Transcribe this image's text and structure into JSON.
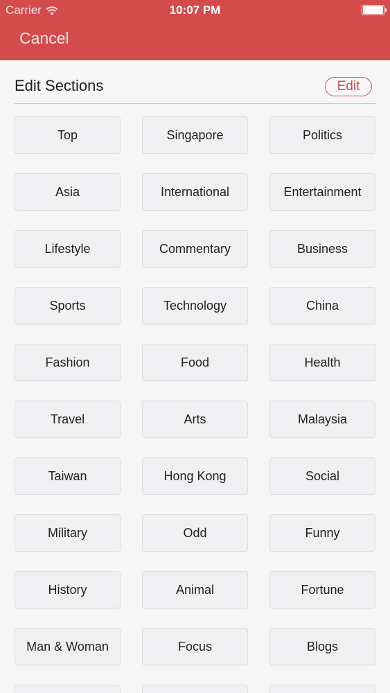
{
  "status_bar": {
    "carrier": "Carrier",
    "time": "10:07 PM"
  },
  "nav": {
    "cancel_label": "Cancel"
  },
  "section": {
    "title": "Edit Sections",
    "edit_label": "Edit"
  },
  "colors": {
    "header": "#d44b4b",
    "accent": "#d44b4b",
    "background": "#f6f6f7",
    "tile": "#f0f0f2"
  },
  "sections": [
    {
      "label": "Top"
    },
    {
      "label": "Singapore"
    },
    {
      "label": "Politics"
    },
    {
      "label": "Asia"
    },
    {
      "label": "International"
    },
    {
      "label": "Entertainment"
    },
    {
      "label": "Lifestyle"
    },
    {
      "label": "Commentary"
    },
    {
      "label": "Business"
    },
    {
      "label": "Sports"
    },
    {
      "label": "Technology"
    },
    {
      "label": "China"
    },
    {
      "label": "Fashion"
    },
    {
      "label": "Food"
    },
    {
      "label": "Health"
    },
    {
      "label": "Travel"
    },
    {
      "label": "Arts"
    },
    {
      "label": "Malaysia"
    },
    {
      "label": "Taiwan"
    },
    {
      "label": "Hong Kong"
    },
    {
      "label": "Social"
    },
    {
      "label": "Military"
    },
    {
      "label": "Odd"
    },
    {
      "label": "Funny"
    },
    {
      "label": "History"
    },
    {
      "label": "Animal"
    },
    {
      "label": "Fortune"
    },
    {
      "label": "Man & Woman"
    },
    {
      "label": "Focus"
    },
    {
      "label": "Blogs"
    },
    {
      "label": ""
    },
    {
      "label": ""
    },
    {
      "label": ""
    }
  ]
}
